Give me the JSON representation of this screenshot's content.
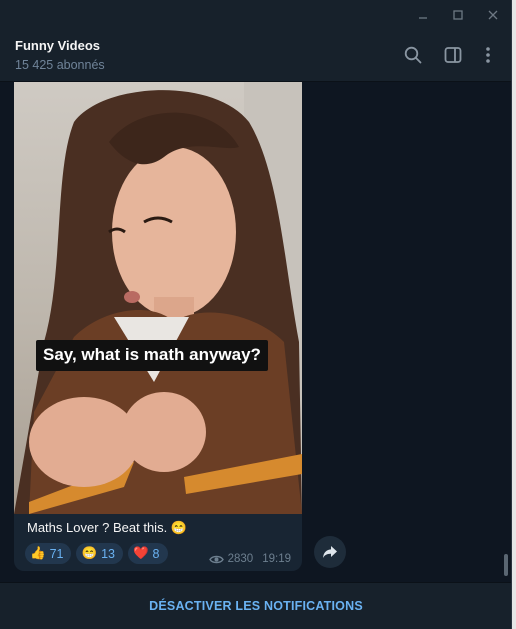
{
  "channel": {
    "name": "Funny Videos",
    "subscribers": "15 425 abonnés"
  },
  "header_icons": [
    "search-icon",
    "sidebar-toggle-icon",
    "more-vertical-icon"
  ],
  "window_controls": [
    "minimize-icon",
    "maximize-icon",
    "close-icon"
  ],
  "message": {
    "video_caption": "Say, what is math anyway?",
    "text": "Maths Lover ? Beat this.",
    "text_emoji": "😁",
    "reactions": [
      {
        "emoji": "👍",
        "count": "71"
      },
      {
        "emoji": "😁",
        "count": "13"
      },
      {
        "emoji": "❤️",
        "count": "8"
      }
    ],
    "views": "2830",
    "time": "19:19"
  },
  "footer": {
    "button_label": "DÉSACTIVER LES NOTIFICATIONS"
  },
  "colors": {
    "background": "#0e1621",
    "panel": "#17212b",
    "bubble": "#182533",
    "accent": "#6ab2f2"
  }
}
